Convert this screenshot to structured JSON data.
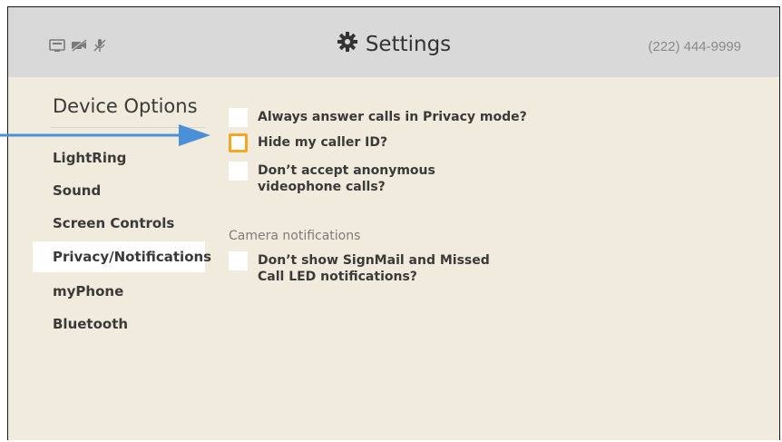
{
  "header": {
    "title": "Settings",
    "title_icon": "gear-icon",
    "phone_number": "(222) 444-9999",
    "status_icons": [
      "network-icon",
      "camera-off-icon",
      "mic-off-icon"
    ]
  },
  "sidebar": {
    "heading": "Device Options",
    "selected": "Privacy/Notifications",
    "items": [
      {
        "label": "LightRing"
      },
      {
        "label": "Sound"
      },
      {
        "label": "Screen Controls"
      },
      {
        "label": "Privacy/Notifications"
      },
      {
        "label": "myPhone"
      },
      {
        "label": "Bluetooth"
      }
    ]
  },
  "privacy": {
    "options": [
      {
        "label": "Always answer calls in Privacy mode?",
        "checked": false
      },
      {
        "label": "Hide my caller ID?",
        "checked": false,
        "focused": true
      },
      {
        "label": "Don’t accept anonymous\nvideophone calls?",
        "checked": false
      }
    ],
    "camera_section_label": "Camera notifications",
    "camera_options": [
      {
        "label": "Don’t show SignMail and Missed\nCall LED notifications?",
        "checked": false
      }
    ]
  },
  "colors": {
    "background": "#f1ebdd",
    "header": "#d9d9d9",
    "focus_highlight": "#f5a623",
    "annotation_arrow": "#4a90d9"
  }
}
